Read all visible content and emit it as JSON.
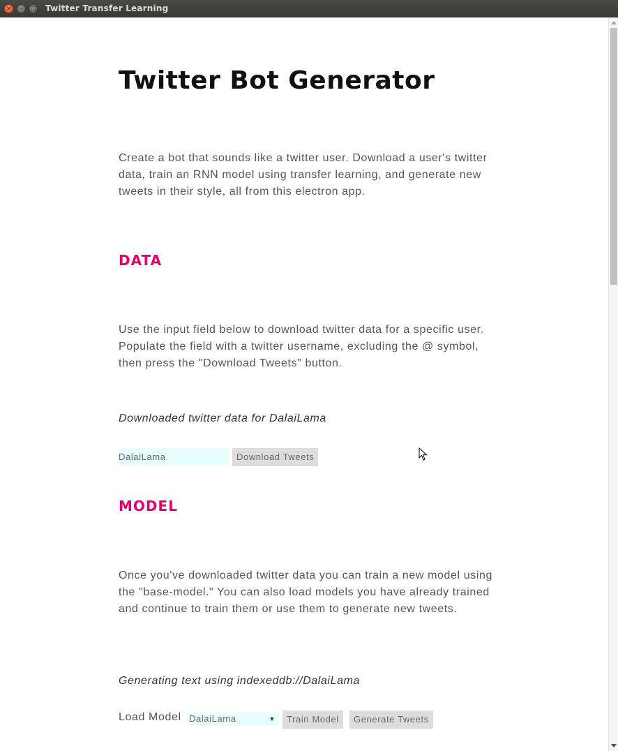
{
  "window": {
    "title": "Twitter Transfer Learning",
    "close_glyph": "×",
    "minimize_glyph": "–",
    "maximize_glyph": "□"
  },
  "page": {
    "title": "Twitter Bot Generator",
    "intro": "Create a bot that sounds like a twitter user. Download a user's twitter data, train an RNN model using transfer learning, and generate new tweets in their style, all from this electron app."
  },
  "data_section": {
    "heading": "DATA",
    "description": "Use the input field below to download twitter data for a specific user. Populate the field with a twitter username, excluding the @ symbol, then press the \"Download Tweets\" button.",
    "status": "Downloaded twitter data for DalaiLama",
    "username_value": "DalaiLama",
    "download_button": "Download Tweets"
  },
  "model_section": {
    "heading": "MODEL",
    "description": "Once you've downloaded twitter data you can train a new model using the \"base-model.\" You can also load models you have already trained and continue to train them or use them to generate new tweets.",
    "status": "Generating text using indexeddb://DalaiLama",
    "load_label": "Load Model",
    "selected_model": "DalaiLama",
    "train_button": "Train Model",
    "generate_button": "Generate Tweets"
  },
  "colors": {
    "accent": "#e0006c",
    "input_bg": "#e8fdfe",
    "button_bg": "#dddddd"
  },
  "icons": {
    "cursor": "mouse-pointer-icon",
    "caret": "caret-down-icon"
  }
}
